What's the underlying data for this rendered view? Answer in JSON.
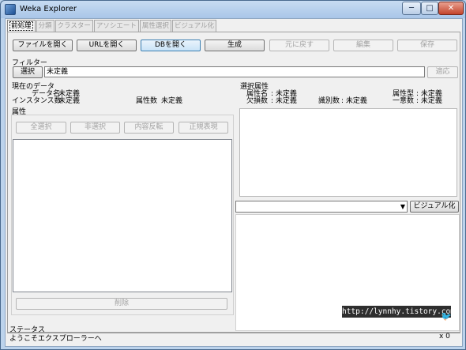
{
  "window": {
    "title": "Weka Explorer",
    "min": "─",
    "max": "□",
    "close": "✕"
  },
  "tabs": [
    {
      "label": "前処理"
    },
    {
      "label": "分類"
    },
    {
      "label": "クラスター"
    },
    {
      "label": "アソシエート"
    },
    {
      "label": "属性選択"
    },
    {
      "label": "ビジュアル化"
    }
  ],
  "toolbar": {
    "open_file": "ファイルを開く",
    "open_url": "URLを開く",
    "open_db": "DBを開く",
    "generate": "生成",
    "undo": "元に戻す",
    "edit": "編集",
    "save": "保存"
  },
  "filter": {
    "label": "フィルター",
    "choose": "選択",
    "value": "未定義",
    "apply": "適応"
  },
  "current_data": {
    "title": "現在のデータ",
    "name_label": "データ名",
    "name_value": "未定義",
    "instances_label": "インスタンス数",
    "instances_value": "未定義",
    "attributes_label": "属性数",
    "attributes_value": "未定義"
  },
  "attributes": {
    "title": "属性",
    "all": "全選択",
    "none": "非選択",
    "invert": "内容反転",
    "pattern": "正規表現",
    "remove": "削除"
  },
  "selected_attribute": {
    "title": "選択属性",
    "name_label": "属性名",
    "name_value": "未定義",
    "type_label": "属性型",
    "type_value": "未定義",
    "missing_label": "欠損数",
    "missing_value": "未定義",
    "distinct_label": "識別数",
    "distinct_value": "未定義",
    "unique_label": "一意数",
    "unique_value": "未定義"
  },
  "visualize": {
    "button": "ビジュアル化",
    "class_value": ""
  },
  "status": {
    "title": "ステータス",
    "message": "ようこそエクスプローラーへ",
    "count_suffix": "x 0"
  },
  "watermark": "http://lynnhy.tistory.com",
  "colors": {
    "title_bar": "#a9c6e8",
    "client_bg": "#f0f0f0",
    "close_button": "#c3442c"
  }
}
